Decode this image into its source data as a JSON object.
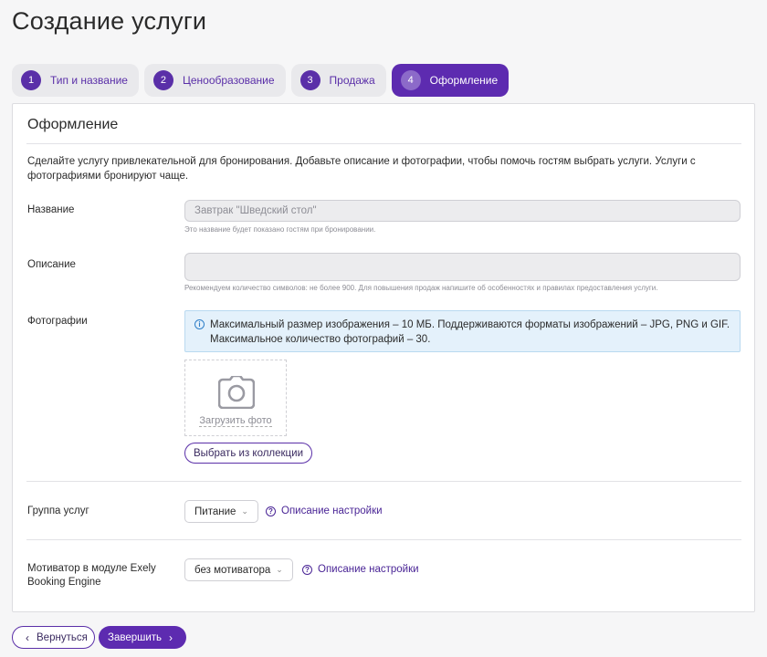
{
  "page": {
    "title": "Создание услуги"
  },
  "steps": [
    {
      "num": "1",
      "label": "Тип и название",
      "active": false
    },
    {
      "num": "2",
      "label": "Ценообразование",
      "active": false
    },
    {
      "num": "3",
      "label": "Продажа",
      "active": false
    },
    {
      "num": "4",
      "label": "Оформление",
      "active": true
    }
  ],
  "section": {
    "title": "Оформление",
    "intro": "Сделайте услугу привлекательной для бронирования. Добавьте описание и фотографии, чтобы помочь гостям выбрать услуги. Услуги с фотографиями бронируют чаще."
  },
  "name_field": {
    "label": "Название",
    "value": "Завтрак \"Шведский стол\"",
    "hint": "Это название будет показано гостям при бронировании."
  },
  "description_field": {
    "label": "Описание",
    "value": "",
    "hint": "Рекомендуем количество символов: не более 900. Для повышения продаж напишите об особенностях и правилах предоставления услуги."
  },
  "photos": {
    "label": "Фотографии",
    "info_line1": "Максимальный размер изображения – 10 МБ. Поддерживаются форматы изображений – JPG, PNG и GIF.",
    "info_line2": "Максимальное количество фотографий – 30.",
    "upload_label": "Загрузить фото",
    "collection_button": "Выбрать из коллекции"
  },
  "service_group": {
    "label": "Группа услуг",
    "selected": "Питание",
    "help_link": "Описание настройки"
  },
  "motivator": {
    "label": "Мотиватор в модуле Exely Booking Engine",
    "selected": "без мотиватора",
    "help_link": "Описание настройки"
  },
  "footer": {
    "back_label": "Вернуться",
    "finish_label": "Завершить"
  },
  "colors": {
    "accent": "#5d2bb0",
    "info_bg": "#e4f1fb",
    "background": "#f6f6f7"
  },
  "icons": {
    "photo_upload": "camera-icon",
    "info": "info-icon",
    "help": "question-circle-icon",
    "select": "chevron-down-icon",
    "back": "chevron-left-icon",
    "finish": "chevron-right-icon"
  }
}
